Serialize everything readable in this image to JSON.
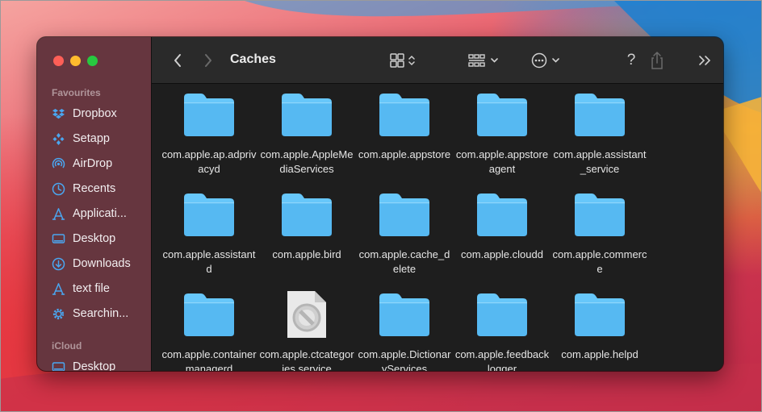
{
  "window": {
    "title": "Caches"
  },
  "sidebar": {
    "favourites_title": "Favourites",
    "icloud_title": "iCloud",
    "favourites": [
      {
        "label": "Dropbox",
        "icon": "dropbox-icon"
      },
      {
        "label": "Setapp",
        "icon": "setapp-icon"
      },
      {
        "label": "AirDrop",
        "icon": "airdrop-icon"
      },
      {
        "label": "Recents",
        "icon": "clock-icon"
      },
      {
        "label": "Applicati...",
        "icon": "applications-icon"
      },
      {
        "label": "Desktop",
        "icon": "desktop-icon"
      },
      {
        "label": "Downloads",
        "icon": "download-icon"
      },
      {
        "label": "text file",
        "icon": "applications-icon"
      },
      {
        "label": "Searchin...",
        "icon": "gear-icon"
      }
    ],
    "icloud": [
      {
        "label": "Desktop",
        "icon": "desktop-icon"
      }
    ]
  },
  "toolbar": {
    "back_icon": "chevron-left-icon",
    "forward_icon": "chevron-right-icon",
    "view_icon": "grid-view-icon",
    "group_icon": "group-by-icon",
    "action_icon": "ellipsis-icon",
    "help_label": "?",
    "share_icon": "share-icon",
    "more_icon": "double-chevron-icon",
    "search_icon": "search-icon"
  },
  "files": [
    {
      "name": "com.apple.ap.adprivacyd",
      "kind": "folder"
    },
    {
      "name": "com.apple.AppleMediaServices",
      "kind": "folder"
    },
    {
      "name": "com.apple.appstore",
      "kind": "folder"
    },
    {
      "name": "com.apple.appstoreagent",
      "kind": "folder"
    },
    {
      "name": "com.apple.assistant_service",
      "kind": "folder"
    },
    {
      "name": "com.apple.assistantd",
      "kind": "folder"
    },
    {
      "name": "com.apple.bird",
      "kind": "folder"
    },
    {
      "name": "com.apple.cache_delete",
      "kind": "folder"
    },
    {
      "name": "com.apple.cloudd",
      "kind": "folder"
    },
    {
      "name": "com.apple.commerce",
      "kind": "folder"
    },
    {
      "name": "com.apple.containermanagerd",
      "kind": "folder"
    },
    {
      "name": "com.apple.ctcategories.service",
      "kind": "restricted-file"
    },
    {
      "name": "com.apple.DictionaryServices",
      "kind": "folder"
    },
    {
      "name": "com.apple.feedbacklogger",
      "kind": "folder"
    },
    {
      "name": "com.apple.helpd",
      "kind": "folder"
    }
  ],
  "colors": {
    "folder_top": "#67c7fa",
    "folder_body": "#56b9f2",
    "sidebar_accent": "#4aa6f0"
  }
}
